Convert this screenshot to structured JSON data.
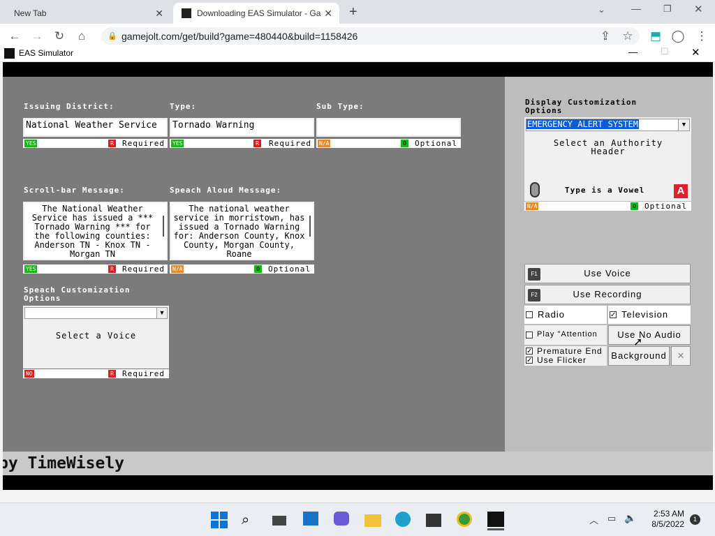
{
  "browser": {
    "tabs": [
      {
        "title": "New Tab"
      },
      {
        "title": "Downloading EAS Simulator - Ga"
      }
    ],
    "url": "gamejolt.com/get/build?game=480440&build=1158426"
  },
  "app": {
    "window_title": "EAS Simulator",
    "issuing_district": {
      "label": "Issuing District:",
      "value": "National Weather Service",
      "status": "YES",
      "flag": "Required"
    },
    "type": {
      "label": "Type:",
      "value": "Tornado Warning",
      "status": "YES",
      "flag": "Required"
    },
    "sub_type": {
      "label": "Sub Type:",
      "value": "",
      "status": "N/A",
      "flag": "Optional"
    },
    "scroll_message": {
      "label": "Scroll-bar Message:",
      "value": "The National Weather Service has issued a *** Tornado Warning *** for the following counties: Anderson TN - Knox TN - Morgan TN",
      "status": "YES",
      "flag": "Required"
    },
    "speech_message": {
      "label": "Speach Aloud Message:",
      "value": "The national weather service in morristown, has issued a Tornado Warning for: Anderson County, Knox County, Morgan County, Roane",
      "status": "N/A",
      "flag": "Optional"
    },
    "speech_options": {
      "label": "Speach Customization Options",
      "select_value": "",
      "placeholder": "Select a Voice",
      "status": "NO",
      "flag": "Required"
    },
    "display_options": {
      "label": "Display Customization Options",
      "header_value": "EMERGENCY ALERT SYSTEM",
      "header_hint": "Select an Authority Header",
      "vowel_text": "Type is a Vowel",
      "vowel_badge": "A",
      "status": "N/A",
      "flag": "Optional"
    },
    "use_voice": "Use Voice",
    "use_recording": "Use Recording",
    "fkey1": "F1",
    "fkey2": "F2",
    "radio": {
      "label": "Radio",
      "checked": false
    },
    "television": {
      "label": "Television",
      "checked": true
    },
    "play_attention": {
      "label": "Play \"Attention",
      "checked": false
    },
    "use_no_audio": "Use No Audio",
    "premature_end": {
      "label": "Premature End",
      "checked": true
    },
    "use_flicker": {
      "label": "Use Flicker",
      "checked": true
    },
    "background_btn": "Background",
    "ticker": "by TimeWisely"
  },
  "taskbar": {
    "time": "2:53 AM",
    "date": "8/5/2022",
    "notification_count": "1"
  }
}
